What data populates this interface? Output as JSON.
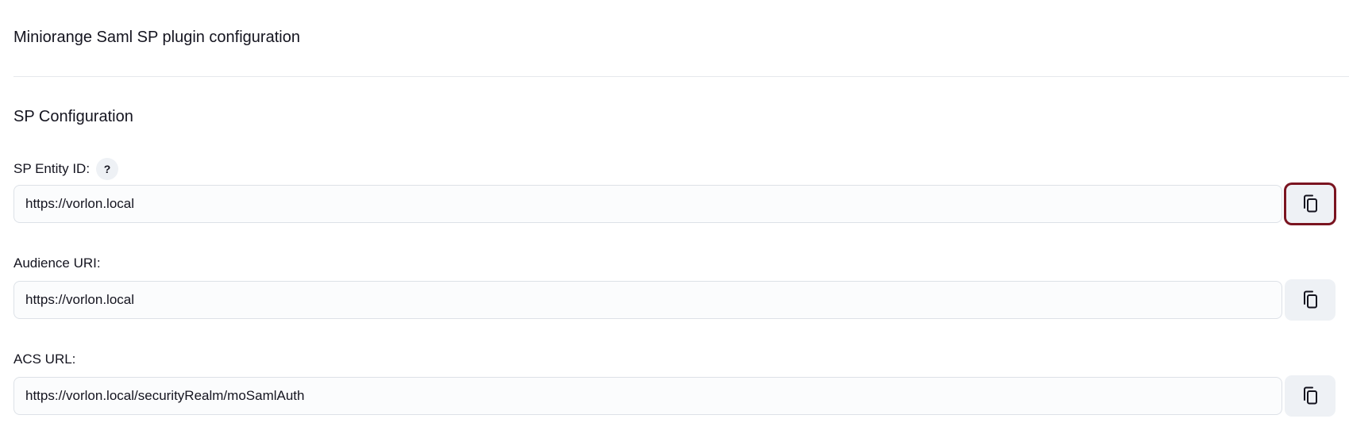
{
  "header": {
    "title": "Miniorange Saml SP plugin configuration"
  },
  "section": {
    "title": "SP Configuration"
  },
  "fields": [
    {
      "label": "SP Entity ID:",
      "help": "?",
      "value": "https://vorlon.local",
      "copy_icon": "copy-icon",
      "copy_focused": true
    },
    {
      "label": "Audience URI:",
      "value": "https://vorlon.local",
      "copy_icon": "copy-icon",
      "copy_focused": false
    },
    {
      "label": "ACS URL:",
      "value": "https://vorlon.local/securityRealm/moSamlAuth",
      "copy_icon": "copy-icon",
      "copy_focused": false
    }
  ],
  "colors": {
    "focus_ring": "#7a1420",
    "button_bg": "#eef1f5",
    "input_border": "#dde1e7",
    "text": "#14141f"
  }
}
